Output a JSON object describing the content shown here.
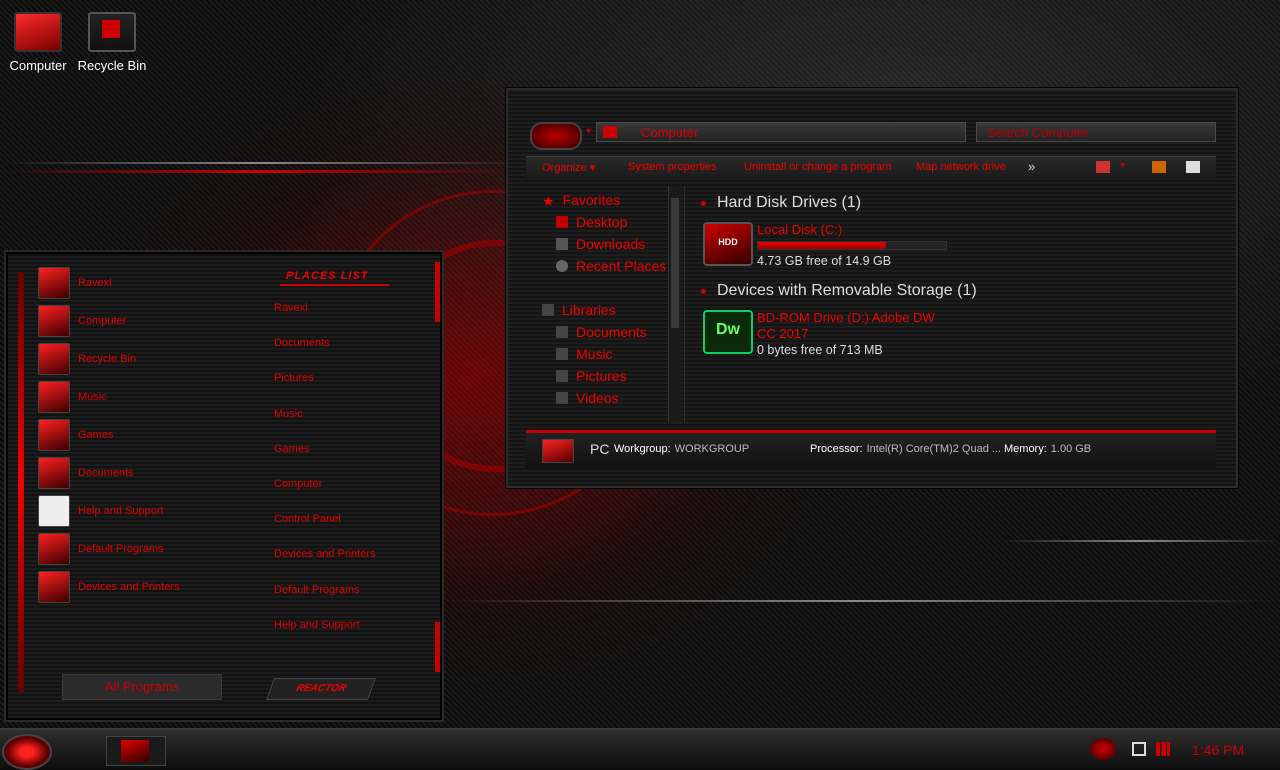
{
  "desktop": {
    "icons": [
      {
        "label": "Computer",
        "icon": "computer-icon"
      },
      {
        "label": "Recycle Bin",
        "icon": "recycle-bin-icon"
      }
    ]
  },
  "start_menu": {
    "left_items": [
      "Ravexl",
      "Computer",
      "Recycle Bin",
      "Music",
      "Games",
      "Documents",
      "Help and Support",
      "Default Programs",
      "Devices and Printers"
    ],
    "places_header": "PLACES LIST",
    "places": [
      "Ravexl",
      "Documents",
      "Pictures",
      "Music",
      "Games",
      "Computer",
      "Control Panel",
      "Devices and Printers",
      "Default Programs",
      "Help and Support"
    ],
    "all_programs": "All Programs",
    "reactor": "REACTOR"
  },
  "explorer": {
    "address": "Computer",
    "search_placeholder": "Search Computer",
    "toolbar": {
      "organize": "Organize",
      "system_properties": "System properties",
      "uninstall": "Uninstall or change a program",
      "map_drive": "Map network drive",
      "more": "»"
    },
    "nav": {
      "favorites": "Favorites",
      "desktop": "Desktop",
      "downloads": "Downloads",
      "recent": "Recent Places",
      "libraries": "Libraries",
      "documents": "Documents",
      "music": "Music",
      "pictures": "Pictures",
      "videos": "Videos"
    },
    "groups": {
      "hdd": "Hard Disk Drives (1)",
      "removable": "Devices with Removable Storage (1)"
    },
    "drives": {
      "c_name": "Local Disk (C:)",
      "c_free": "4.73 GB free of 14.9 GB",
      "c_used_fraction": 0.68,
      "d_name_line1": "BD-ROM Drive (D:) Adobe DW",
      "d_name_line2": "CC 2017",
      "d_free": "0 bytes free of 713 MB",
      "hdd_icon_text": "HDD",
      "dw_icon_text": "Dw"
    },
    "details": {
      "name": "PC",
      "workgroup_label": "Workgroup:",
      "workgroup": "WORKGROUP",
      "processor_label": "Processor:",
      "processor": "Intel(R) Core(TM)2 Quad ...",
      "memory_label": "Memory:",
      "memory": "1.00 GB"
    }
  },
  "taskbar": {
    "clock": "1:46 PM"
  },
  "colors": {
    "accent": "#e00000",
    "text": "#dddddd",
    "background": "#0a0a0a"
  }
}
